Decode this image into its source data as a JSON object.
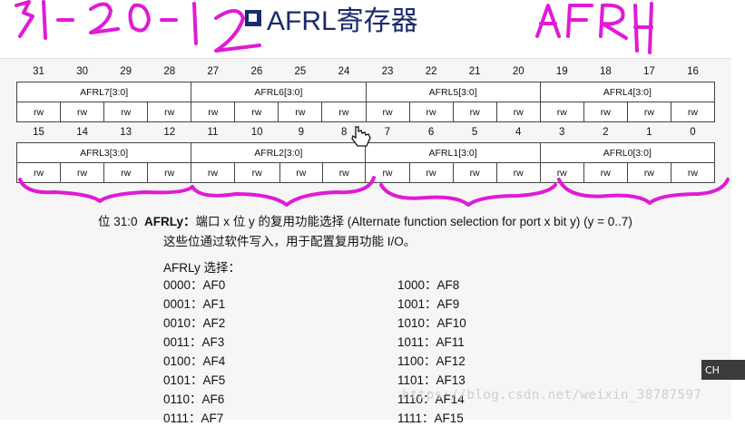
{
  "title": "AFRL寄存器",
  "upper_bits": [
    "31",
    "30",
    "29",
    "28",
    "27",
    "26",
    "25",
    "24",
    "23",
    "22",
    "21",
    "20",
    "19",
    "18",
    "17",
    "16"
  ],
  "upper_fields": [
    "AFRL7[3:0]",
    "AFRL6[3:0]",
    "AFRL5[3:0]",
    "AFRL4[3:0]"
  ],
  "lower_bits": [
    "15",
    "14",
    "13",
    "12",
    "11",
    "10",
    "9",
    "8",
    "7",
    "6",
    "5",
    "4",
    "3",
    "2",
    "1",
    "0"
  ],
  "lower_fields": [
    "AFRL3[3:0]",
    "AFRL2[3:0]",
    "AFRL1[3:0]",
    "AFRL0[3:0]"
  ],
  "access": "rw",
  "description": {
    "bits": "位 31:0",
    "name": "AFRLy：",
    "text1": "端口 x 位 y 的复用功能选择 (Alternate function selection for port x bit y) (y = 0..7)",
    "text2": "这些位通过软件写入，用于配置复用功能 I/O。",
    "select_heading": "AFRLy 选择："
  },
  "codes_left": [
    "0000：AF0",
    "0001：AF1",
    "0010：AF2",
    "0011：AF3",
    "0100：AF4",
    "0101：AF5",
    "0110：AF6",
    "0111：AF7"
  ],
  "codes_right": [
    "1000：AF8",
    "1001：AF9",
    "1010：AF10",
    "1011：AF11",
    "1100：AF12",
    "1101：AF13",
    "1110：AF14",
    "1111：AF15"
  ],
  "watermark": "https://blog.csdn.net/weixin_38787597",
  "ime_badge": "CH",
  "colors": {
    "title": "#1a2a6c",
    "annotation": "#e01ad6"
  }
}
